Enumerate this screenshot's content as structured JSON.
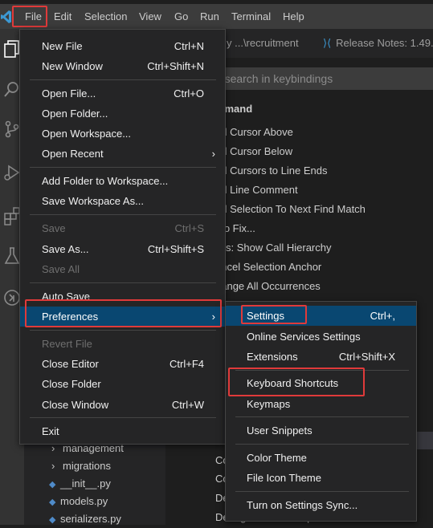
{
  "menubar": {
    "items": [
      "File",
      "Edit",
      "Selection",
      "View",
      "Go",
      "Run",
      "Terminal",
      "Help"
    ]
  },
  "tabs": [
    {
      "label": "y ...\\recruitment"
    },
    {
      "label": "Release Notes: 1.49."
    }
  ],
  "keybindings": {
    "search_placeholder": "to search in keybindings",
    "header": "ommand",
    "commands": [
      "dd Cursor Above",
      "dd Cursor Below",
      "dd Cursors to Line Ends",
      "dd Line Comment",
      "dd Selection To Next Find Match",
      "uto Fix...",
      "alls: Show Call Hierarchy",
      "ancel Selection Anchor",
      "hange All Occurrences"
    ],
    "bottom_commands": [
      "Co",
      "Co",
      "De",
      "Debug: Inline Breakpoint"
    ]
  },
  "explorer": {
    "items": [
      {
        "label": "management",
        "kind": "folder"
      },
      {
        "label": "migrations",
        "kind": "folder"
      },
      {
        "label": "__init__.py",
        "kind": "python"
      },
      {
        "label": "models.py",
        "kind": "python"
      },
      {
        "label": "serializers.py",
        "kind": "python"
      }
    ]
  },
  "file_menu": {
    "items": [
      {
        "label": "New File",
        "shortcut": "Ctrl+N"
      },
      {
        "label": "New Window",
        "shortcut": "Ctrl+Shift+N"
      },
      {
        "label": "Open File...",
        "shortcut": "Ctrl+O"
      },
      {
        "label": "Open Folder...",
        "shortcut": ""
      },
      {
        "label": "Open Workspace...",
        "shortcut": ""
      },
      {
        "label": "Open Recent",
        "shortcut": ""
      },
      {
        "label": "Add Folder to Workspace...",
        "shortcut": ""
      },
      {
        "label": "Save Workspace As...",
        "shortcut": ""
      },
      {
        "label": "Save",
        "shortcut": "Ctrl+S"
      },
      {
        "label": "Save As...",
        "shortcut": "Ctrl+Shift+S"
      },
      {
        "label": "Save All",
        "shortcut": ""
      },
      {
        "label": "Auto Save",
        "shortcut": ""
      },
      {
        "label": "Preferences",
        "shortcut": ""
      },
      {
        "label": "Revert File",
        "shortcut": ""
      },
      {
        "label": "Close Editor",
        "shortcut": "Ctrl+F4"
      },
      {
        "label": "Close Folder",
        "shortcut": ""
      },
      {
        "label": "Close Window",
        "shortcut": "Ctrl+W"
      },
      {
        "label": "Exit",
        "shortcut": ""
      }
    ]
  },
  "preferences_menu": {
    "items": [
      {
        "label": "Settings",
        "shortcut": "Ctrl+,"
      },
      {
        "label": "Online Services Settings",
        "shortcut": ""
      },
      {
        "label": "Extensions",
        "shortcut": "Ctrl+Shift+X"
      },
      {
        "label": "Keyboard Shortcuts",
        "shortcut": ""
      },
      {
        "label": "Keymaps",
        "shortcut": ""
      },
      {
        "label": "User Snippets",
        "shortcut": ""
      },
      {
        "label": "Color Theme",
        "shortcut": ""
      },
      {
        "label": "File Icon Theme",
        "shortcut": ""
      },
      {
        "label": "Turn on Settings Sync...",
        "shortcut": ""
      }
    ]
  },
  "colors": {
    "accent_highlight": "#e03a3a",
    "selection": "#094771",
    "vscode_blue": "#3c99d4"
  }
}
